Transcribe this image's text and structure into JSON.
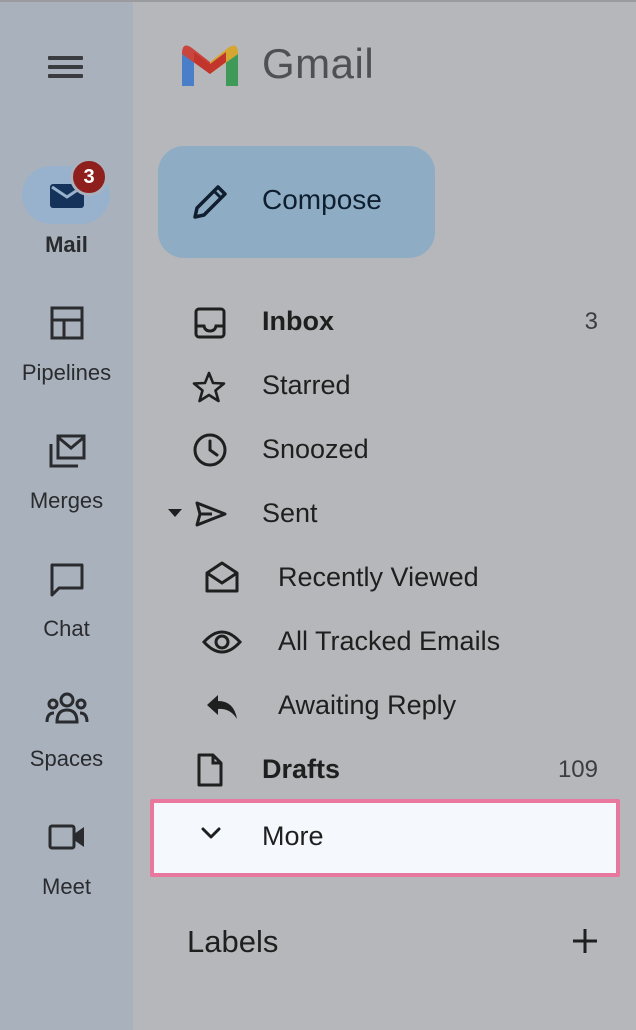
{
  "rail": {
    "items": [
      {
        "label": "Mail",
        "icon": "mail-icon",
        "badge": "3",
        "active": true
      },
      {
        "label": "Pipelines",
        "icon": "pipelines-icon"
      },
      {
        "label": "Merges",
        "icon": "merges-icon"
      },
      {
        "label": "Chat",
        "icon": "chat-icon"
      },
      {
        "label": "Spaces",
        "icon": "spaces-icon"
      },
      {
        "label": "Meet",
        "icon": "meet-icon"
      }
    ]
  },
  "header": {
    "brand": "Gmail"
  },
  "compose": {
    "label": "Compose"
  },
  "nav": {
    "items": [
      {
        "label": "Inbox",
        "count": "3",
        "icon": "inbox-icon"
      },
      {
        "label": "Starred",
        "icon": "star-icon"
      },
      {
        "label": "Snoozed",
        "icon": "clock-icon"
      },
      {
        "label": "Sent",
        "icon": "send-icon"
      },
      {
        "label": "Recently Viewed",
        "icon": "open-mail-icon"
      },
      {
        "label": "All Tracked Emails",
        "icon": "eye-icon"
      },
      {
        "label": "Awaiting Reply",
        "icon": "reply-icon"
      },
      {
        "label": "Drafts",
        "count": "109",
        "icon": "draft-icon"
      }
    ],
    "more": {
      "label": "More"
    }
  },
  "labels": {
    "title": "Labels"
  },
  "colors": {
    "highlight_border": "#e9789e",
    "badge": "#8e1f1d",
    "compose_bg": "#8eadc4"
  }
}
